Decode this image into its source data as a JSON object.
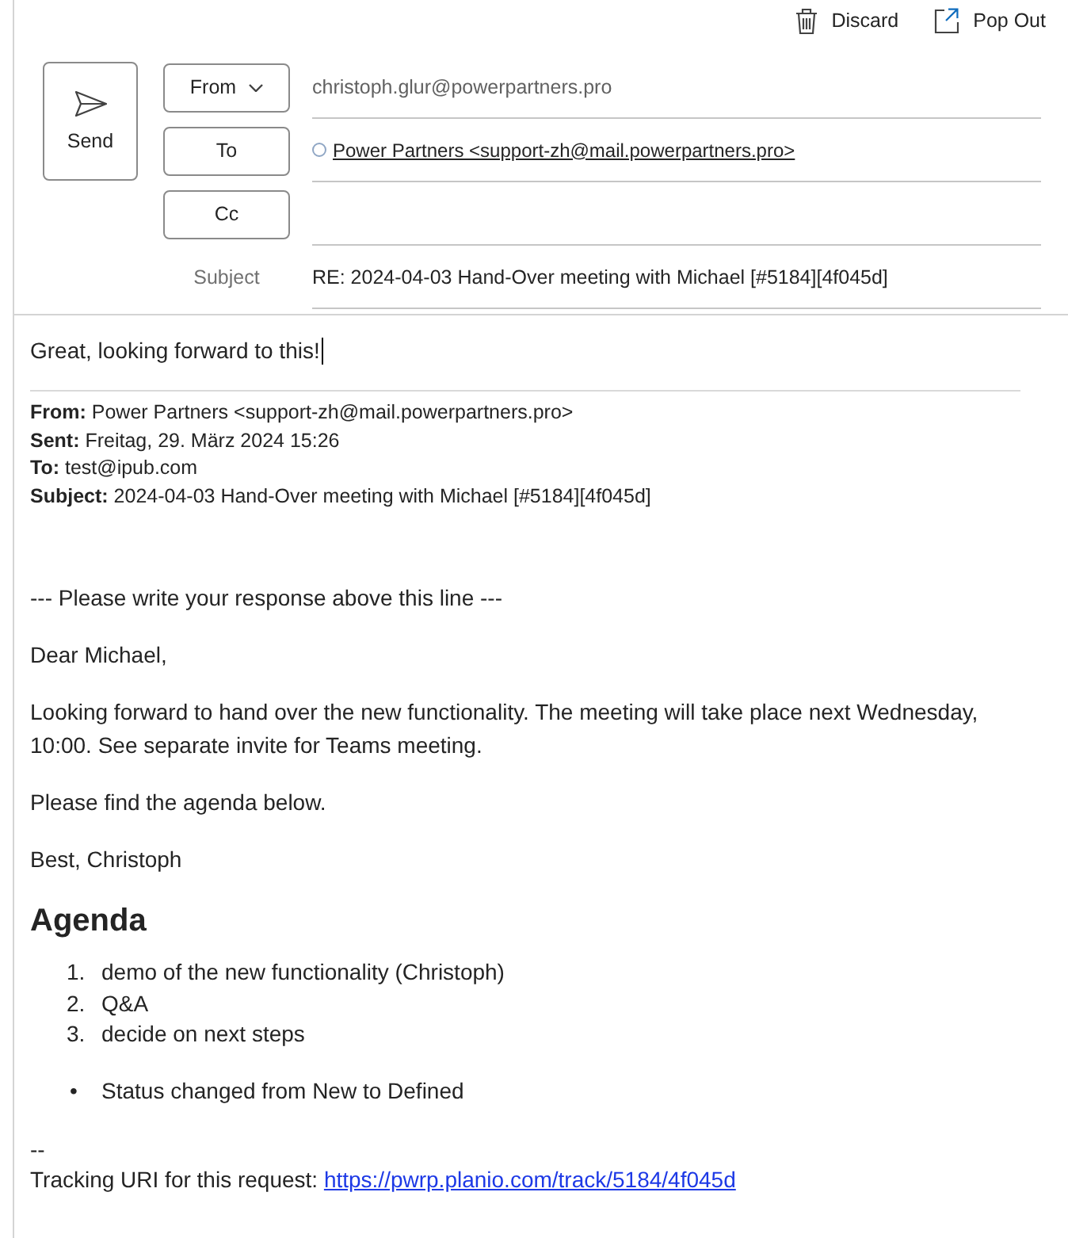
{
  "toolbar": {
    "actions": [
      {
        "kind": "discard",
        "label": "Discard"
      },
      {
        "kind": "pop_out",
        "label": "Pop Out"
      }
    ]
  },
  "compose": {
    "send_button": "Send",
    "from": {
      "button": "From",
      "value": "christoph.glur@powerpartners.pro"
    },
    "to": {
      "button": "To",
      "recipients": [
        {
          "label": "Power Partners <support-zh@mail.powerpartners.pro>"
        }
      ]
    },
    "cc": {
      "button": "Cc"
    },
    "subject": {
      "label": "Subject",
      "value": "RE: 2024-04-03 Hand-Over meeting with Michael [#5184][4f045d]"
    }
  },
  "body": {
    "reply_text": "Great, looking forward to this!",
    "quoted_header": [
      "**From:** Power Partners <support-zh@mail.powerpartners.pro>",
      "**Sent:** Freitag, 29. März 2024 15:26",
      "**To:** test@ipub.com",
      "**Subject:** 2024-04-03 Hand-Over meeting with Michael [#5184][4f045d]"
    ],
    "paragraphs": [
      "--- Please write your response above this line ---",
      "Dear Michael,",
      "Looking forward to hand over the new functionality. The meeting will take place next Wednesday, 10:00. See separate invite for Teams meeting.",
      "Please find the agenda below.",
      "Best, Christoph"
    ],
    "heading": "Agenda",
    "numbered_list": [
      {
        "marker": "1.",
        "text": "demo of the new functionality (Christoph)"
      },
      {
        "marker": "2.",
        "text": "Q&A"
      },
      {
        "marker": "3.",
        "text": "decide on next steps"
      }
    ],
    "bullet_list": [
      {
        "marker": "•",
        "text": "Status changed from New to Defined"
      }
    ],
    "signature_separator": "--",
    "tracking": {
      "text": "Tracking URI for this request:",
      "link": "https://pwrp.planio.com/track/5184/4f045d"
    }
  }
}
